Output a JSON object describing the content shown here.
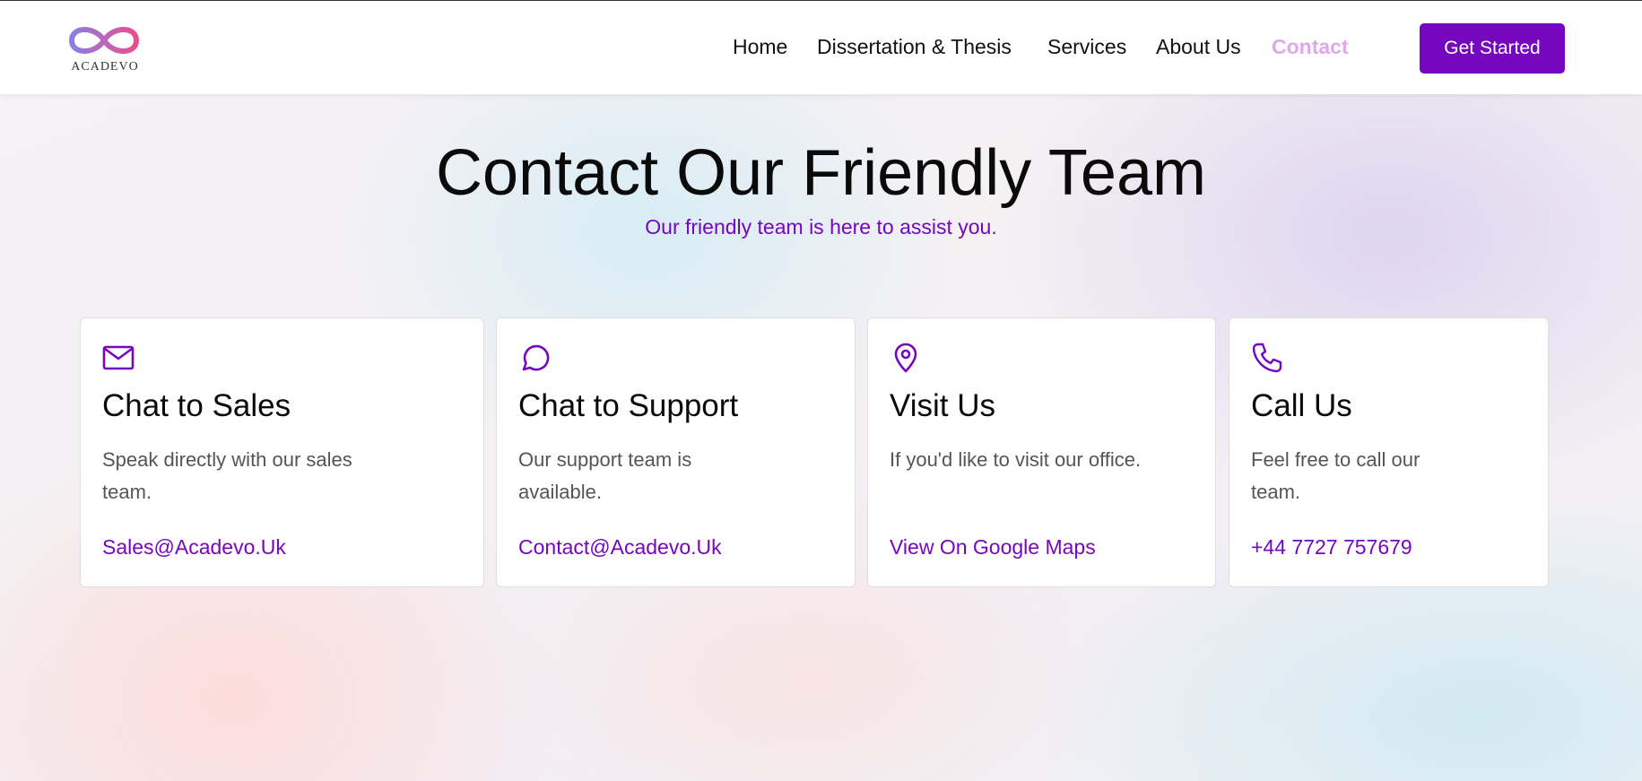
{
  "header": {
    "logo_text": "ACADEVO",
    "nav": [
      {
        "label": "Home"
      },
      {
        "label": "Dissertation & Thesis"
      },
      {
        "label": "Services"
      },
      {
        "label": "About Us"
      },
      {
        "label": "Contact",
        "active": true
      }
    ],
    "cta_label": "Get Started"
  },
  "hero": {
    "title": "Contact Our Friendly Team",
    "subtitle": "Our friendly team is here to assist you."
  },
  "cards": [
    {
      "icon": "mail-icon",
      "title": "Chat to Sales",
      "text": "Speak directly with our sales team.",
      "link": "Sales@Acadevo.Uk"
    },
    {
      "icon": "chat-bubble-icon",
      "title": "Chat to Support",
      "text": "Our support team is available.",
      "link": "Contact@Acadevo.Uk"
    },
    {
      "icon": "map-pin-icon",
      "title": "Visit Us",
      "text": "If you'd like to visit our office.",
      "link": "View On Google Maps"
    },
    {
      "icon": "phone-icon",
      "title": "Call Us",
      "text": "Feel free to call our team.",
      "link": "+44 7727 757679"
    }
  ],
  "colors": {
    "accent": "#7508bf",
    "nav_active": "#e0a7ec",
    "logo_gradient_start": "#8c7fe3",
    "logo_gradient_end": "#ec4d8f"
  }
}
